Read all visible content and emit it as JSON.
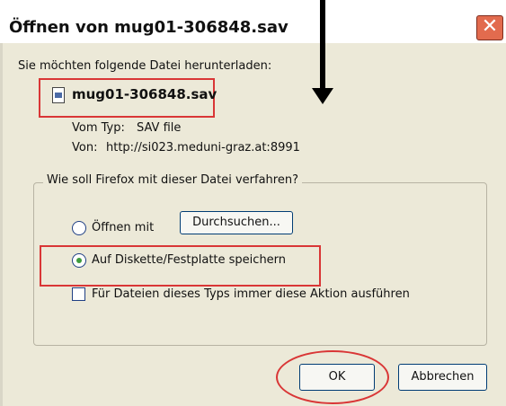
{
  "window": {
    "title": "Öffnen von mug01-306848.sav",
    "close_glyph": "✕"
  },
  "intro": "Sie möchten folgende Datei herunterladen:",
  "file": {
    "name": "mug01-306848.sav",
    "type_label": "Vom Typ:",
    "type_value": "SAV file",
    "from_label": "Von:",
    "from_value": "http://si023.meduni-graz.at:8991"
  },
  "group": {
    "legend": "Wie soll Firefox mit dieser Datei verfahren?",
    "open_with_label": "Öffnen mit",
    "browse_button": "Durchsuchen...",
    "save_label": "Auf Diskette/Festplatte speichern",
    "always_label": "Für Dateien dieses Typs immer diese Aktion ausführen",
    "save_selected": true,
    "always_checked": false
  },
  "buttons": {
    "ok": "OK",
    "cancel": "Abbrechen"
  },
  "colors": {
    "annotation_red": "#d93636",
    "dialog_bg": "#ece9d8",
    "close_red": "#e26b4e"
  },
  "icons": [
    "close-icon",
    "file-sav-icon",
    "annotation-arrow-icon"
  ]
}
